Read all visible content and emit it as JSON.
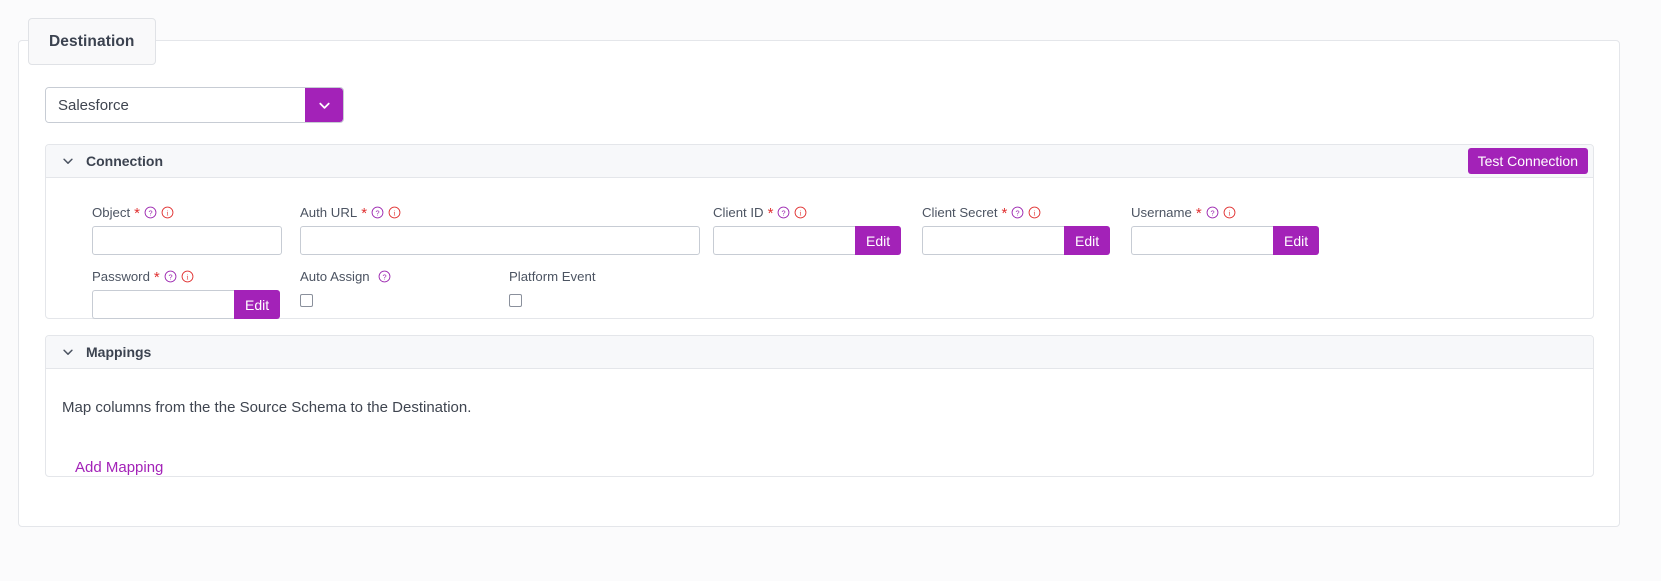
{
  "tab": {
    "label": "Destination"
  },
  "destination_select": {
    "value": "Salesforce",
    "options": [
      "Salesforce"
    ],
    "arrow_icon": "chevron-down-icon",
    "accent_color": "#a322b8"
  },
  "connection": {
    "title": "Connection",
    "collapse_icon": "chevron-down-icon",
    "test_button": "Test Connection",
    "fields": [
      {
        "label": "Object",
        "required": true,
        "help_icon": "question-circle-icon",
        "info_icon": "info-circle-icon",
        "type": "text",
        "value": "",
        "has_edit": false,
        "edit_label": ""
      },
      {
        "label": "Auth URL",
        "required": true,
        "help_icon": "question-circle-icon",
        "info_icon": "info-circle-icon",
        "type": "text",
        "value": "",
        "has_edit": false,
        "edit_label": ""
      },
      {
        "label": "Client ID",
        "required": true,
        "help_icon": "question-circle-icon",
        "info_icon": "info-circle-icon",
        "type": "text",
        "value": "",
        "has_edit": true,
        "edit_label": "Edit"
      },
      {
        "label": "Client Secret",
        "required": true,
        "help_icon": "question-circle-icon",
        "info_icon": "info-circle-icon",
        "type": "text",
        "value": "",
        "has_edit": true,
        "edit_label": "Edit"
      },
      {
        "label": "Username",
        "required": true,
        "help_icon": "question-circle-icon",
        "info_icon": "info-circle-icon",
        "type": "text",
        "value": "",
        "has_edit": true,
        "edit_label": "Edit"
      },
      {
        "label": "Password",
        "required": true,
        "help_icon": "question-circle-icon",
        "info_icon": "info-circle-icon",
        "type": "text",
        "value": "",
        "has_edit": true,
        "edit_label": "Edit"
      },
      {
        "label": "Auto Assign",
        "required": false,
        "help_icon": "question-circle-icon",
        "info_icon": "",
        "type": "checkbox",
        "checked": false,
        "has_edit": false,
        "edit_label": ""
      },
      {
        "label": "Platform Event",
        "required": false,
        "help_icon": "",
        "info_icon": "",
        "type": "checkbox",
        "checked": false,
        "has_edit": false,
        "edit_label": ""
      }
    ]
  },
  "mappings": {
    "title": "Mappings",
    "collapse_icon": "chevron-down-icon",
    "description": "Map columns from the the Source Schema to the Destination.",
    "add_link": "Add Mapping"
  },
  "colors": {
    "accent": "#a322b8",
    "required_red": "#e03030",
    "info_red": "#e03030",
    "help_purple": "#9c27b0",
    "text": "#3f4550",
    "panel_border": "#e4e6ea",
    "header_bg": "#f7f8fa",
    "page_bg": "#fbfbfc"
  }
}
